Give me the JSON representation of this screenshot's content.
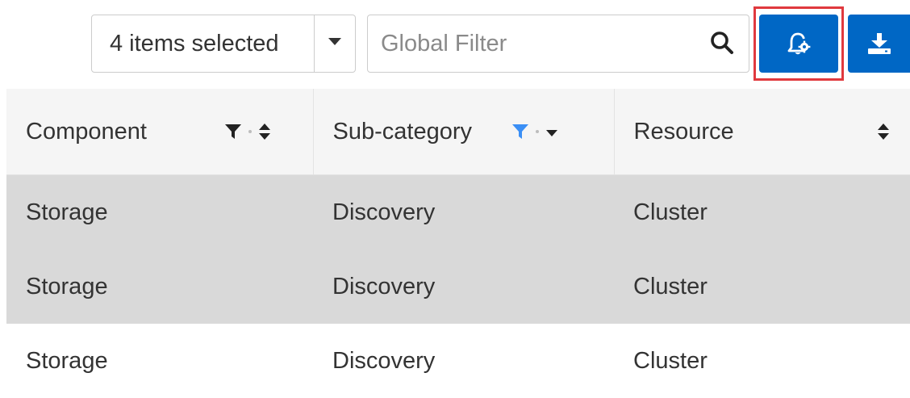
{
  "toolbar": {
    "selection_label": "4 items selected",
    "global_filter": {
      "placeholder": "Global Filter",
      "value": ""
    },
    "icons": {
      "dropdown": "caret-down-icon",
      "search": "search-icon",
      "alert_settings": "bell-gear-icon",
      "download": "download-icon"
    },
    "accent_color": "#0067c5",
    "highlight_color": "#e0393e"
  },
  "table": {
    "columns": [
      {
        "label": "Component",
        "filter_active": false
      },
      {
        "label": "Sub-category",
        "filter_active": true
      },
      {
        "label": "Resource",
        "filter_active": false
      }
    ],
    "filter_active_color": "#3b8ff5",
    "rows": [
      {
        "cells": [
          "Storage",
          "Discovery",
          "Cluster"
        ],
        "selected": true
      },
      {
        "cells": [
          "Storage",
          "Discovery",
          "Cluster"
        ],
        "selected": true
      },
      {
        "cells": [
          "Storage",
          "Discovery",
          "Cluster"
        ],
        "selected": false
      }
    ]
  }
}
